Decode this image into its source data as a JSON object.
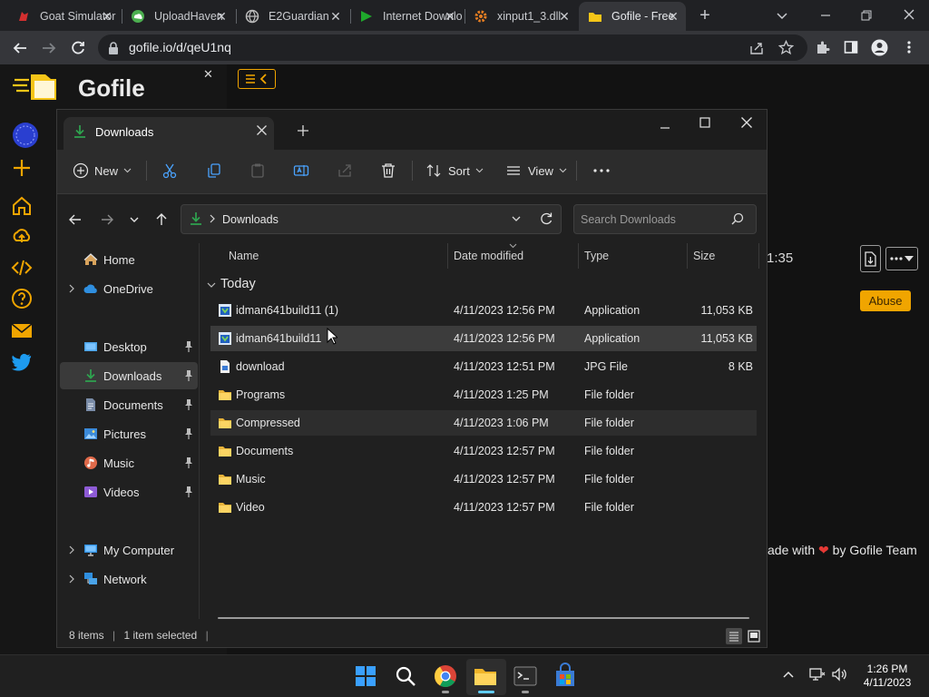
{
  "browser": {
    "tabs": [
      {
        "title": "Goat Simulator",
        "icon": "goat-favicon",
        "active": false
      },
      {
        "title": "UploadHaven",
        "icon": "cloud-favicon",
        "active": false
      },
      {
        "title": "E2Guardian",
        "icon": "globe-favicon",
        "active": false
      },
      {
        "title": "Internet Download Manager",
        "icon": "flag-favicon",
        "active": false
      },
      {
        "title": "xinput1_3.dll",
        "icon": "gear-favicon",
        "active": false
      },
      {
        "title": "Gofile - Free",
        "icon": "folder-favicon",
        "active": true
      }
    ],
    "url": "gofile.io/d/qeU1nq"
  },
  "gofile": {
    "title": "Gofile",
    "time_fragment": "1:35",
    "abuse_label": "Abuse",
    "footer_pre": "ade with",
    "footer_post": "by Gofile Team",
    "accent": "#f0a500"
  },
  "explorer": {
    "tab_title": "Downloads",
    "commands": {
      "new": "New",
      "sort": "Sort",
      "view": "View"
    },
    "address": "Downloads",
    "search_placeholder": "Search Downloads",
    "nav": [
      {
        "label": "Home",
        "icon": "home-icon",
        "pinned": false,
        "expandable": false
      },
      {
        "label": "OneDrive",
        "icon": "cloud-icon",
        "pinned": false,
        "expandable": true
      },
      {
        "label": "Desktop",
        "icon": "desktop-icon",
        "pinned": true,
        "expandable": false
      },
      {
        "label": "Downloads",
        "icon": "download-icon",
        "pinned": true,
        "expandable": false,
        "selected": true
      },
      {
        "label": "Documents",
        "icon": "documents-icon",
        "pinned": true,
        "expandable": false
      },
      {
        "label": "Pictures",
        "icon": "pictures-icon",
        "pinned": true,
        "expandable": false
      },
      {
        "label": "Music",
        "icon": "music-icon",
        "pinned": true,
        "expandable": false
      },
      {
        "label": "Videos",
        "icon": "videos-icon",
        "pinned": true,
        "expandable": false
      },
      {
        "label": "My Computer",
        "icon": "computer-icon",
        "pinned": false,
        "expandable": true
      },
      {
        "label": "Network",
        "icon": "network-icon",
        "pinned": false,
        "expandable": true
      }
    ],
    "columns": {
      "name": "Name",
      "date": "Date modified",
      "type": "Type",
      "size": "Size"
    },
    "group": "Today",
    "files": [
      {
        "name": "idman641build11 (1)",
        "date": "4/11/2023 12:56 PM",
        "type": "Application",
        "size": "11,053 KB",
        "icon": "app-icon"
      },
      {
        "name": "idman641build11",
        "date": "4/11/2023 12:56 PM",
        "type": "Application",
        "size": "11,053 KB",
        "icon": "app-icon",
        "selected": true
      },
      {
        "name": "download",
        "date": "4/11/2023 12:51 PM",
        "type": "JPG File",
        "size": "8 KB",
        "icon": "image-file-icon"
      },
      {
        "name": "Programs",
        "date": "4/11/2023 1:25 PM",
        "type": "File folder",
        "size": "",
        "icon": "folder-icon"
      },
      {
        "name": "Compressed",
        "date": "4/11/2023 1:06 PM",
        "type": "File folder",
        "size": "",
        "icon": "folder-icon",
        "hover": true
      },
      {
        "name": "Documents",
        "date": "4/11/2023 12:57 PM",
        "type": "File folder",
        "size": "",
        "icon": "folder-icon"
      },
      {
        "name": "Music",
        "date": "4/11/2023 12:57 PM",
        "type": "File folder",
        "size": "",
        "icon": "folder-icon"
      },
      {
        "name": "Video",
        "date": "4/11/2023 12:57 PM",
        "type": "File folder",
        "size": "",
        "icon": "folder-icon"
      }
    ],
    "status": {
      "count": "8 items",
      "selection": "1 item selected"
    }
  },
  "taskbar": {
    "time": "1:26 PM",
    "date": "4/11/2023"
  }
}
